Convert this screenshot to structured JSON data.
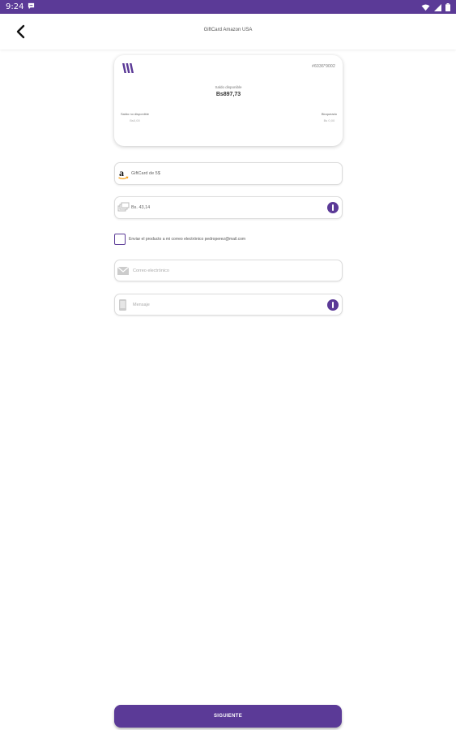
{
  "status_bar": {
    "time": "9:24",
    "icons": [
      "chat-notification-icon",
      "wifi-icon",
      "signal-icon",
      "battery-icon"
    ]
  },
  "app_bar": {
    "title": "GiftCard Amazon USA",
    "back_icon": "chevron-left-icon"
  },
  "card": {
    "logo_icon": "brand-logo-icon",
    "number": "#6036*9002",
    "balance_label": "Saldo disponible",
    "balance": "Bs897,73",
    "left_label": "Saldo no disponible",
    "left_value": "Bs0,00",
    "right_label": "Bloqueado",
    "right_value": "Bs 0,00"
  },
  "fields": {
    "product": {
      "icon": "amazon-icon",
      "value": "GiftCard de 5$"
    },
    "amount": {
      "icon": "money-icon",
      "value": "Bs. 43,14",
      "info_icon": "info-icon"
    },
    "send_email": {
      "label": "Enviar el producto a mi correo electrónico pedroperez@mail.com",
      "checked": false
    },
    "email": {
      "icon": "envelope-icon",
      "placeholder": "Correo electrónico"
    },
    "message": {
      "icon": "phone-icon",
      "placeholder": "Mensaje",
      "info_icon": "info-icon"
    }
  },
  "footer": {
    "next_label": "SIGUIENTE"
  },
  "colors": {
    "primary": "#5b3a97",
    "background": "#ffffff"
  }
}
